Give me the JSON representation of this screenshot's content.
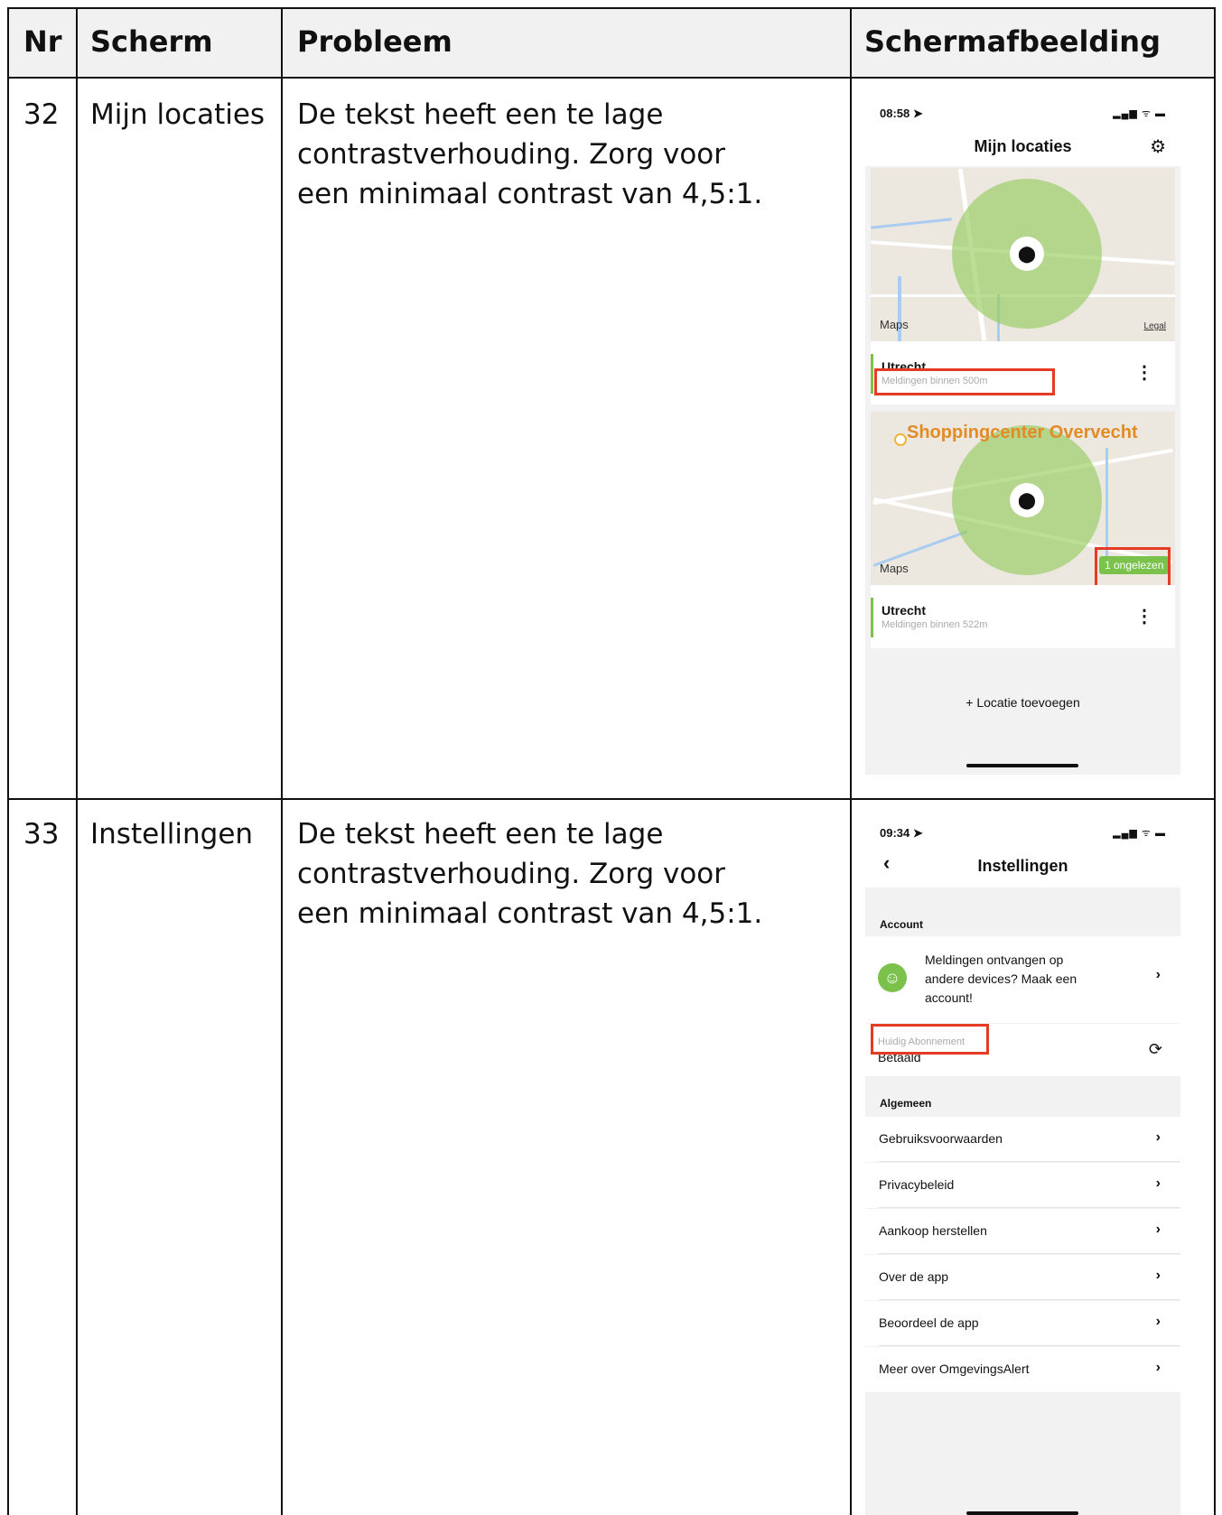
{
  "table": {
    "headers": {
      "nr": "Nr",
      "scherm": "Scherm",
      "probleem": "Probleem",
      "schermafbeelding": "Schermafbeelding"
    },
    "rows": [
      {
        "nr": "32",
        "scherm": "Mijn locaties",
        "probleem": "De tekst heeft een te lage contrastverhouding. Zorg voor een minimaal contrast van 4,5:1."
      },
      {
        "nr": "33",
        "scherm": "Instellingen",
        "probleem": "De tekst heeft een te lage contrastverhouding. Zorg voor een minimaal contrast van 4,5:1."
      }
    ]
  },
  "screen1": {
    "time": "08:58 ➤",
    "status_icons": "▂▄▆ ᯤ ▬",
    "title": "Mijn locaties",
    "settings_icon": "gear-icon",
    "maps_label": "Maps",
    "legal_label": "Legal",
    "shopping_label": "Shoppingcenter Overvecht",
    "cards": [
      {
        "name": "Utrecht",
        "subtitle": "Meldingen binnen 500m"
      },
      {
        "name": "Utrecht",
        "subtitle": "Meldingen binnen 522m"
      }
    ],
    "unread_badge": "1 ongelezen",
    "add_location": "+  Locatie toevoegen",
    "highlight_color": "#e53a24",
    "accent_color": "#7ac24b"
  },
  "screen2": {
    "time": "09:34 ➤",
    "status_icons": "▂▄▆ ᯤ ▬",
    "back": "‹",
    "title": "Instellingen",
    "account_section": "Account",
    "account_prompt": "Meldingen ontvangen op andere devices? Maak een account!",
    "subscription_label": "Huidig Abonnement",
    "subscription_value": "Betaald",
    "refresh_icon": "refresh-icon",
    "general_section": "Algemeen",
    "items": [
      "Gebruiksvoorwaarden",
      "Privacybeleid",
      "Aankoop herstellen",
      "Over de app",
      "Beoordeel de app",
      "Meer over OmgevingsAlert"
    ],
    "chevron": "›"
  }
}
